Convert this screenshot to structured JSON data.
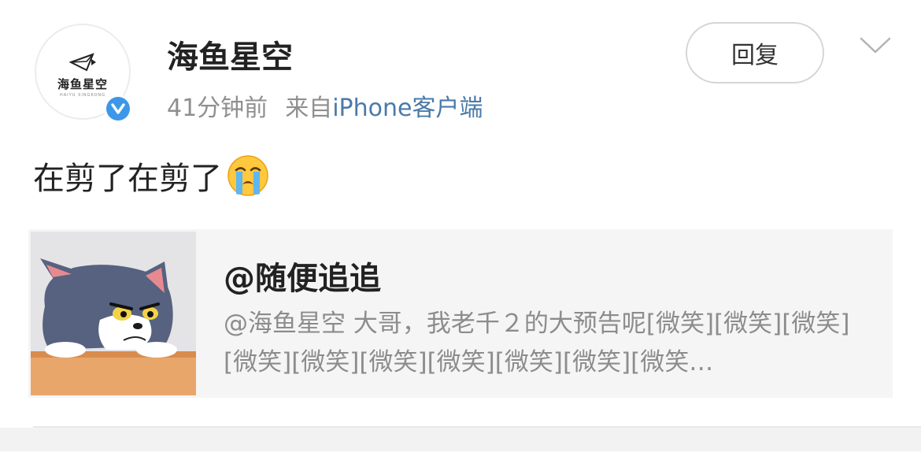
{
  "post": {
    "author_name": "海鱼星空",
    "avatar": {
      "logo_text": "海鱼星空",
      "logo_subtext": "HAIYU XINGKONG",
      "verified_icon": "verified-v-icon",
      "verified_color": "#3d97e8"
    },
    "timestamp": "41分钟前",
    "source_prefix": "来自",
    "source_name": "iPhone客户端",
    "source_color": "#4a7aa8",
    "reply_label": "回复",
    "menu_icon": "chevron-down-icon",
    "text": "在剪了在剪了",
    "emoji": "crying-emoji-icon"
  },
  "quote": {
    "thumbnail": "cartoon-cat-image",
    "author": "@随便追追",
    "body": "@海鱼星空 大哥，我老千２的大预告呢[微笑][微笑][微笑][微笑][微笑][微笑][微笑][微笑][微笑][微笑…"
  }
}
